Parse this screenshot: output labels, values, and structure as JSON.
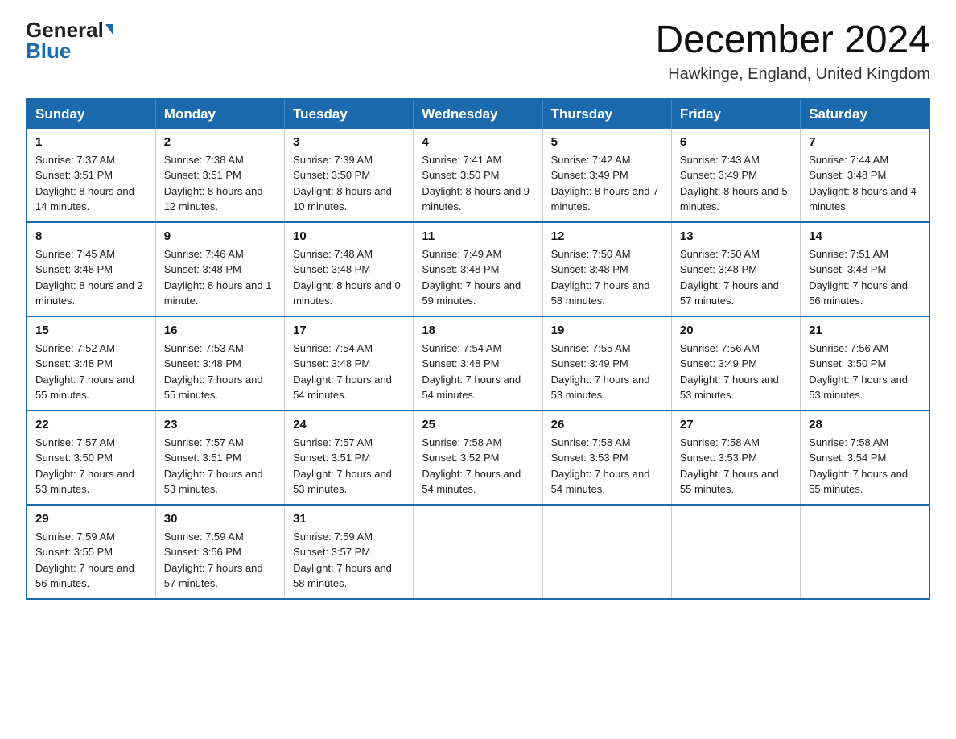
{
  "header": {
    "logo_general": "General",
    "logo_blue": "Blue",
    "month_title": "December 2024",
    "location": "Hawkinge, England, United Kingdom"
  },
  "days_of_week": [
    "Sunday",
    "Monday",
    "Tuesday",
    "Wednesday",
    "Thursday",
    "Friday",
    "Saturday"
  ],
  "weeks": [
    [
      {
        "day": "1",
        "sunrise": "7:37 AM",
        "sunset": "3:51 PM",
        "daylight": "8 hours and 14 minutes."
      },
      {
        "day": "2",
        "sunrise": "7:38 AM",
        "sunset": "3:51 PM",
        "daylight": "8 hours and 12 minutes."
      },
      {
        "day": "3",
        "sunrise": "7:39 AM",
        "sunset": "3:50 PM",
        "daylight": "8 hours and 10 minutes."
      },
      {
        "day": "4",
        "sunrise": "7:41 AM",
        "sunset": "3:50 PM",
        "daylight": "8 hours and 9 minutes."
      },
      {
        "day": "5",
        "sunrise": "7:42 AM",
        "sunset": "3:49 PM",
        "daylight": "8 hours and 7 minutes."
      },
      {
        "day": "6",
        "sunrise": "7:43 AM",
        "sunset": "3:49 PM",
        "daylight": "8 hours and 5 minutes."
      },
      {
        "day": "7",
        "sunrise": "7:44 AM",
        "sunset": "3:48 PM",
        "daylight": "8 hours and 4 minutes."
      }
    ],
    [
      {
        "day": "8",
        "sunrise": "7:45 AM",
        "sunset": "3:48 PM",
        "daylight": "8 hours and 2 minutes."
      },
      {
        "day": "9",
        "sunrise": "7:46 AM",
        "sunset": "3:48 PM",
        "daylight": "8 hours and 1 minute."
      },
      {
        "day": "10",
        "sunrise": "7:48 AM",
        "sunset": "3:48 PM",
        "daylight": "8 hours and 0 minutes."
      },
      {
        "day": "11",
        "sunrise": "7:49 AM",
        "sunset": "3:48 PM",
        "daylight": "7 hours and 59 minutes."
      },
      {
        "day": "12",
        "sunrise": "7:50 AM",
        "sunset": "3:48 PM",
        "daylight": "7 hours and 58 minutes."
      },
      {
        "day": "13",
        "sunrise": "7:50 AM",
        "sunset": "3:48 PM",
        "daylight": "7 hours and 57 minutes."
      },
      {
        "day": "14",
        "sunrise": "7:51 AM",
        "sunset": "3:48 PM",
        "daylight": "7 hours and 56 minutes."
      }
    ],
    [
      {
        "day": "15",
        "sunrise": "7:52 AM",
        "sunset": "3:48 PM",
        "daylight": "7 hours and 55 minutes."
      },
      {
        "day": "16",
        "sunrise": "7:53 AM",
        "sunset": "3:48 PM",
        "daylight": "7 hours and 55 minutes."
      },
      {
        "day": "17",
        "sunrise": "7:54 AM",
        "sunset": "3:48 PM",
        "daylight": "7 hours and 54 minutes."
      },
      {
        "day": "18",
        "sunrise": "7:54 AM",
        "sunset": "3:48 PM",
        "daylight": "7 hours and 54 minutes."
      },
      {
        "day": "19",
        "sunrise": "7:55 AM",
        "sunset": "3:49 PM",
        "daylight": "7 hours and 53 minutes."
      },
      {
        "day": "20",
        "sunrise": "7:56 AM",
        "sunset": "3:49 PM",
        "daylight": "7 hours and 53 minutes."
      },
      {
        "day": "21",
        "sunrise": "7:56 AM",
        "sunset": "3:50 PM",
        "daylight": "7 hours and 53 minutes."
      }
    ],
    [
      {
        "day": "22",
        "sunrise": "7:57 AM",
        "sunset": "3:50 PM",
        "daylight": "7 hours and 53 minutes."
      },
      {
        "day": "23",
        "sunrise": "7:57 AM",
        "sunset": "3:51 PM",
        "daylight": "7 hours and 53 minutes."
      },
      {
        "day": "24",
        "sunrise": "7:57 AM",
        "sunset": "3:51 PM",
        "daylight": "7 hours and 53 minutes."
      },
      {
        "day": "25",
        "sunrise": "7:58 AM",
        "sunset": "3:52 PM",
        "daylight": "7 hours and 54 minutes."
      },
      {
        "day": "26",
        "sunrise": "7:58 AM",
        "sunset": "3:53 PM",
        "daylight": "7 hours and 54 minutes."
      },
      {
        "day": "27",
        "sunrise": "7:58 AM",
        "sunset": "3:53 PM",
        "daylight": "7 hours and 55 minutes."
      },
      {
        "day": "28",
        "sunrise": "7:58 AM",
        "sunset": "3:54 PM",
        "daylight": "7 hours and 55 minutes."
      }
    ],
    [
      {
        "day": "29",
        "sunrise": "7:59 AM",
        "sunset": "3:55 PM",
        "daylight": "7 hours and 56 minutes."
      },
      {
        "day": "30",
        "sunrise": "7:59 AM",
        "sunset": "3:56 PM",
        "daylight": "7 hours and 57 minutes."
      },
      {
        "day": "31",
        "sunrise": "7:59 AM",
        "sunset": "3:57 PM",
        "daylight": "7 hours and 58 minutes."
      },
      null,
      null,
      null,
      null
    ]
  ],
  "labels": {
    "sunrise": "Sunrise: ",
    "sunset": "Sunset: ",
    "daylight": "Daylight: "
  }
}
